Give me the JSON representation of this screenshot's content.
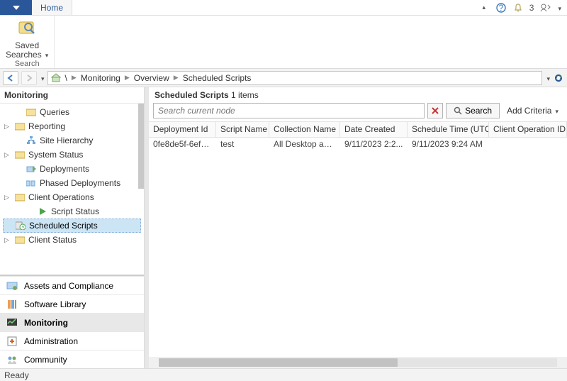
{
  "tabs": {
    "home": "Home"
  },
  "titlebar": {
    "notifications": "3"
  },
  "ribbon": {
    "savedSearches": {
      "label": "Saved\nSearches",
      "group": "Search"
    }
  },
  "breadcrumb": {
    "items": [
      "Monitoring",
      "Overview",
      "Scheduled Scripts"
    ]
  },
  "sidebar": {
    "title": "Monitoring",
    "tree": [
      {
        "label": "Queries"
      },
      {
        "label": "Reporting"
      },
      {
        "label": "Site Hierarchy"
      },
      {
        "label": "System Status"
      },
      {
        "label": "Deployments"
      },
      {
        "label": "Phased Deployments"
      },
      {
        "label": "Client Operations"
      },
      {
        "label": "Script Status"
      },
      {
        "label": "Scheduled Scripts"
      },
      {
        "label": "Client Status"
      }
    ],
    "wunderbar": [
      {
        "label": "Assets and Compliance"
      },
      {
        "label": "Software Library"
      },
      {
        "label": "Monitoring"
      },
      {
        "label": "Administration"
      },
      {
        "label": "Community"
      }
    ]
  },
  "list": {
    "title": "Scheduled Scripts",
    "countText": "1 items",
    "searchPlaceholder": "Search current node",
    "searchBtn": "Search",
    "addCriteria": "Add Criteria",
    "columns": [
      "Deployment Id",
      "Script Name",
      "Collection Name",
      "Date Created",
      "Schedule Time (UTC)",
      "Client Operation ID"
    ],
    "rows": [
      {
        "cells": [
          "0fe8de5f-6ef5-...",
          "test",
          "All Desktop and...",
          "9/11/2023 2:2...",
          "9/11/2023 9:24 AM",
          ""
        ]
      }
    ]
  },
  "status": {
    "text": "Ready"
  }
}
